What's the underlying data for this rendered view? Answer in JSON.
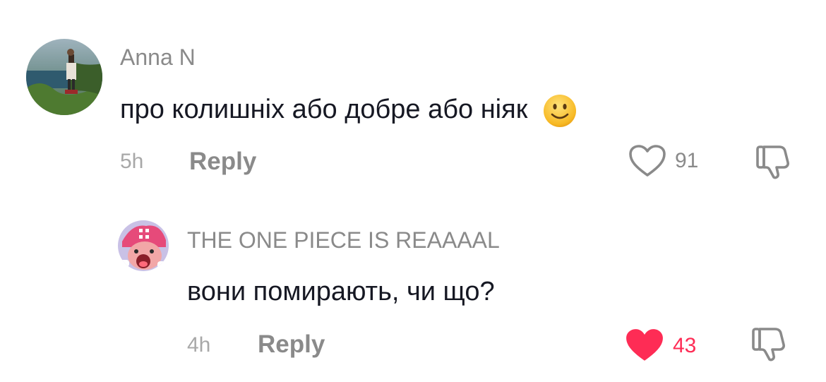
{
  "comments": [
    {
      "username": "Anna N",
      "text": "про колишніх або добре або ніяк",
      "emoji": "🙂",
      "time": "5h",
      "reply_label": "Reply",
      "likes": "91",
      "liked": false,
      "avatar_icon": "user-avatar-landscape-photo"
    },
    {
      "username": "THE ONE PIECE IS REAAAAL",
      "text": "вони помирають, чи що?",
      "time": "4h",
      "reply_label": "Reply",
      "likes": "43",
      "liked": true,
      "avatar_icon": "user-avatar-cartoon-character"
    }
  ],
  "colors": {
    "username": "#8a8a8a",
    "text": "#161823",
    "time": "#a8a8a8",
    "like_active": "#fe2c55",
    "icon": "#8a8a8a"
  }
}
